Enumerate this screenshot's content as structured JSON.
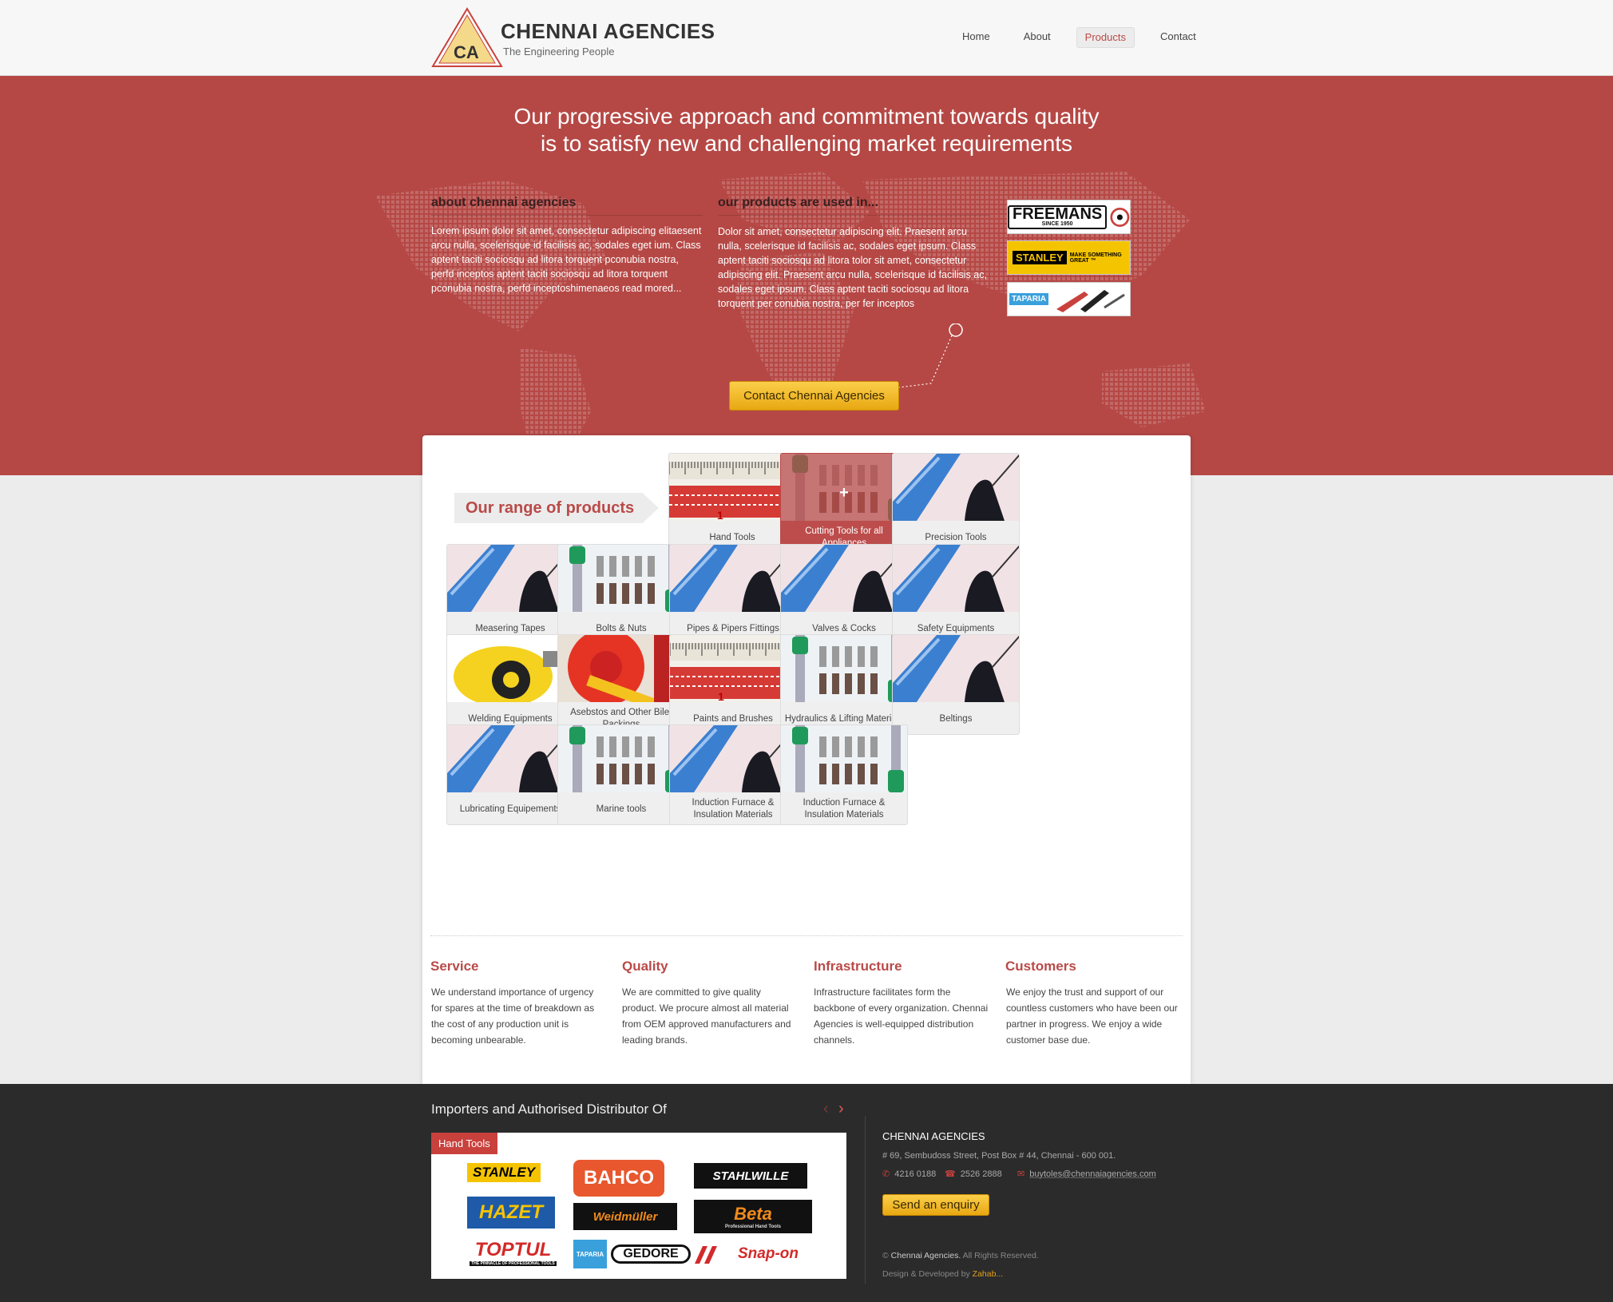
{
  "brand": {
    "name": "CHENNAI AGENCIES",
    "tagline": "The Engineering People",
    "mark": "CA"
  },
  "nav": [
    {
      "label": "Home",
      "active": false
    },
    {
      "label": "About",
      "active": false
    },
    {
      "label": "Products",
      "active": true
    },
    {
      "label": "Contact",
      "active": false
    }
  ],
  "hero": {
    "title_line1": "Our progressive approach and commitment towards quality",
    "title_line2": "is to satisfy new and challenging market requirements",
    "about_heading": "about chennai agencies",
    "about_text": "Lorem ipsum dolor sit amet, consectetur adipiscing elitaesent arcu nulla, scelerisque id facilisis ac, sodales eget ium. Class aptent taciti sociosqu ad litora torquent pconubia nostra, perfd inceptos aptent taciti sociosqu ad litora torquent pconubia nostra, perfd inceptoshimenaeos read mored...",
    "products_heading": "our products are used in...",
    "products_text": "Dolor sit amet, consectetur adipiscing elit. Praesent arcu nulla, scelerisque id facilisis ac, sodales eget ipsum. Class aptent taciti sociosqu ad litora tolor sit amet, consectetur adipiscing elit. Praesent arcu nulla, scelerisque id facilisis ac, sodales eget ipsum. Class aptent taciti sociosqu ad litora torquent per conubia nostra, per fer inceptos",
    "brand_badges": [
      "FREEMANS",
      "STANLEY",
      "TAPARIA"
    ],
    "badge_sub": {
      "freemans": "SINCE 1950",
      "stanley": "MAKE SOMETHING GREAT ™"
    },
    "cta": "Contact Chennai Agencies"
  },
  "products": {
    "heading": "Our range of products",
    "tiles": [
      {
        "label": "Hand Tools",
        "image": "tape-measure"
      },
      {
        "label": "Cutting Tools for all Appliances",
        "image": "bits",
        "hover": true
      },
      {
        "label": "Precision Tools",
        "image": "tool-handles"
      },
      {
        "label": "Measering Tapes",
        "image": "tool-handles"
      },
      {
        "label": "Bolts & Nuts",
        "image": "bits"
      },
      {
        "label": "Pipes & Pipers Fittings",
        "image": "tool-handles"
      },
      {
        "label": "Valves & Cocks",
        "image": "tool-handles"
      },
      {
        "label": "Safety Equipments",
        "image": "tool-handles"
      },
      {
        "label": "Welding Equipments",
        "image": "yellow-tape"
      },
      {
        "label": "Asebstos and Other Biler Packings",
        "image": "red-tape"
      },
      {
        "label": "Paints and Brushes",
        "image": "tape-measure"
      },
      {
        "label": "Hydraulics & Lifting Materials",
        "image": "bits"
      },
      {
        "label": "Beltings",
        "image": "tool-handles"
      },
      {
        "label": "Lubricating Equipements",
        "image": "tool-handles"
      },
      {
        "label": "Marine tools",
        "image": "bits"
      },
      {
        "label": "Induction Furnace & Insulation Materials",
        "image": "tool-handles"
      },
      {
        "label": "Induction Furnace & Insulation Materials",
        "image": "bits"
      }
    ]
  },
  "features": [
    {
      "title": "Service",
      "text": "We understand importance of urgency for spares at the time of breakdown as the cost of any production unit is becoming unbearable."
    },
    {
      "title": "Quality",
      "text": "We are committed to give quality product. We procure almost all material from OEM approved manufacturers and leading brands."
    },
    {
      "title": "Infrastructure",
      "text": "Infrastructure facilitates form the backbone of every organization. Chennai Agencies is well-equipped distribution channels."
    },
    {
      "title": "Customers",
      "text": "We enjoy the trust and support of our countless customers who have been our partner in progress. We enjoy a wide customer base due."
    }
  ],
  "footer": {
    "distributor_title": "Importers and Authorised Distributor Of",
    "active_tab": "Hand Tools",
    "brand_logos": [
      "STANLEY",
      "BAHCO",
      "STAHLWILLE",
      "HAZET",
      "Weidmüller",
      "Beta",
      "TOPTUL",
      "TAPARIA",
      "GEDORE",
      "Snap-on"
    ],
    "beta_sub": "Professional Hand Tools",
    "toptul_sub": "THE PINNACLE OF PROFESSIONAL TOOLS",
    "company_name": "CHENNAI AGENCIES",
    "address": "# 69, Sembudoss Street,  Post Box # 44,  Chennai - 600 001.",
    "phone1": "4216 0188",
    "phone2": "2526 2888",
    "email": "buytoles@chennaiagencies.com",
    "enquiry_btn": "Send an enquiry",
    "copyright_prefix": "©",
    "copyright_name": "Chennai Agencies.",
    "copyright_suffix": "All Rights Reserved.",
    "credit_prefix": "Design & Developed by",
    "credit_name": "Zahab..."
  },
  "colors": {
    "accent": "#b94a48",
    "hero_bg": "#b54845",
    "cta": "#f0b52a",
    "footer_bg": "#2b2b2b"
  }
}
